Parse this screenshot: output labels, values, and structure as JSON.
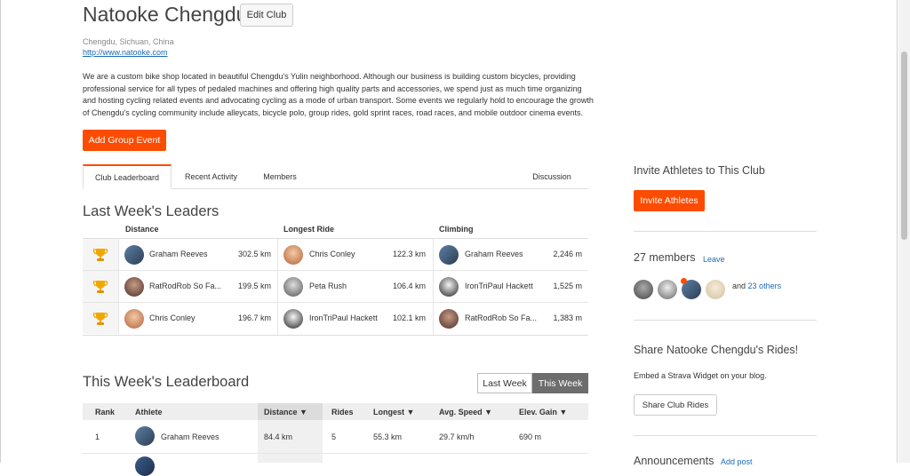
{
  "club": {
    "name": "Natooke Chengdu",
    "edit_label": "Edit Club",
    "location": "Chengdu, Sichuan, China",
    "website": "http://www.natooke.com",
    "description": "We are a custom bike shop located in beautiful Chengdu's Yulin neighborhood. Although our business is building custom bicycles, providing professional service for all types of pedaled machines and offering high quality parts and accessories, we spend just as much time organizing and hosting cycling related events and advocating cycling as a mode of urban transport. Some events we regularly hold to encourage the growth of Chengdu's cycling community include alleycats, bicycle polo, group rides, gold sprint races, road races, and mobile outdoor cinema events.",
    "add_event_label": "Add Group Event"
  },
  "tabs": [
    "Club Leaderboard",
    "Recent Activity",
    "Members",
    "Discussion"
  ],
  "last_week": {
    "title": "Last Week's Leaders",
    "headers": [
      "Distance",
      "Longest Ride",
      "Climbing"
    ],
    "rows": [
      {
        "distance_name": "Graham Reeves",
        "distance_val": "302.5 km",
        "longest_name": "Chris Conley",
        "longest_val": "122.3 km",
        "climb_name": "Graham Reeves",
        "climb_val": "2,246 m"
      },
      {
        "distance_name": "RatRodRob So Fa...",
        "distance_val": "199.5 km",
        "longest_name": "Peta Rush",
        "longest_val": "106.4 km",
        "climb_name": "IronTriPaul Hackett",
        "climb_val": "1,525 m"
      },
      {
        "distance_name": "Chris Conley",
        "distance_val": "196.7 km",
        "longest_name": "IronTriPaul Hackett",
        "longest_val": "102.1 km",
        "climb_name": "RatRodRob So Fa...",
        "climb_val": "1,383 m"
      }
    ]
  },
  "this_week": {
    "title": "This Week's Leaderboard",
    "toggle_last": "Last Week",
    "toggle_this": "This Week",
    "columns": [
      "Rank",
      "Athlete",
      "Distance ▼",
      "Rides",
      "Longest ▼",
      "Avg. Speed ▼",
      "Elev. Gain ▼"
    ],
    "rows": [
      {
        "rank": "1",
        "athlete": "Graham Reeves",
        "distance": "84.4 km",
        "rides": "5",
        "longest": "55.3 km",
        "speed": "29.7 km/h",
        "elev": "690 m"
      }
    ]
  },
  "sidebar": {
    "invite_title": "Invite Athletes to This Club",
    "invite_button": "Invite Athletes",
    "members_count": "27 members",
    "leave_label": "Leave",
    "and_label": "and",
    "others_link": "23 others",
    "share_title": "Share Natooke Chengdu's Rides!",
    "share_desc": "Embed a Strava Widget on your blog.",
    "share_button": "Share Club Rides",
    "announcements_title": "Announcements",
    "add_post": "Add post"
  },
  "colors": {
    "accent": "#fc4c02",
    "link": "#1a6bb5"
  }
}
